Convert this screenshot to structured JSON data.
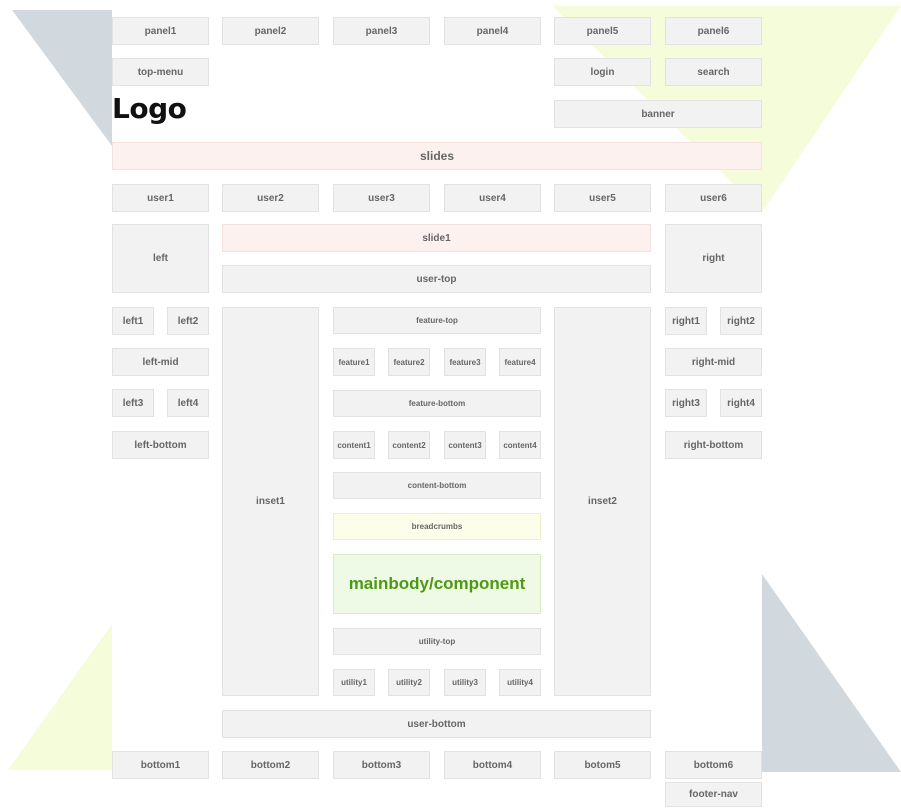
{
  "logo": "Logo",
  "positions": {
    "panel1": "panel1",
    "panel2": "panel2",
    "panel3": "panel3",
    "panel4": "panel4",
    "panel5": "panel5",
    "panel6": "panel6",
    "top_menu": "top-menu",
    "login": "login",
    "search": "search",
    "banner": "banner",
    "slides": "slides",
    "user1": "user1",
    "user2": "user2",
    "user3": "user3",
    "user4": "user4",
    "user5": "user5",
    "user6": "user6",
    "left": "left",
    "slide1": "slide1",
    "user_top": "user-top",
    "right": "right",
    "left1": "left1",
    "left2": "left2",
    "left_mid": "left-mid",
    "left3": "left3",
    "left4": "left4",
    "left_bottom": "left-bottom",
    "inset1": "inset1",
    "inset2": "inset2",
    "feature_top": "feature-top",
    "feature1": "feature1",
    "feature2": "feature2",
    "feature3": "feature3",
    "feature4": "feature4",
    "feature_bottom": "feature-bottom",
    "content1": "content1",
    "content2": "content2",
    "content3": "content3",
    "content4": "content4",
    "content_bottom": "content-bottom",
    "breadcrumbs": "breadcrumbs",
    "mainbody": "mainbody/component",
    "utility_top": "utility-top",
    "utility1": "utility1",
    "utility2": "utility2",
    "utility3": "utility3",
    "utility4": "utility4",
    "right1": "right1",
    "right2": "right2",
    "right_mid": "right-mid",
    "right3": "right3",
    "right4": "right4",
    "right_bottom": "right-bottom",
    "user_bottom": "user-bottom",
    "bottom1": "bottom1",
    "bottom2": "bottom2",
    "bottom3": "bottom3",
    "bottom4": "bottom4",
    "botom5": "botom5",
    "bottom6": "bottom6",
    "footer_nav": "footer-nav"
  },
  "colors": {
    "module_fill": "#f2f2f2",
    "slides_fill": "#fdf1f0",
    "breadcrumbs_fill": "#fdfeea",
    "mainbody_fill": "#eefae6",
    "mainbody_text": "#4d9a12",
    "deco_gray": "#d2d9de",
    "deco_yellow": "#f4fcd9"
  }
}
